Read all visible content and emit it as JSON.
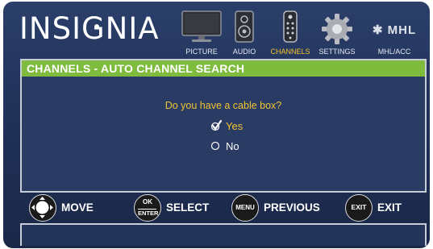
{
  "brand": {
    "name_a": "INSI",
    "name_b": "G",
    "name_c": "NIA"
  },
  "nav": {
    "tabs": [
      {
        "key": "picture",
        "label": "PICTURE",
        "active": false
      },
      {
        "key": "audio",
        "label": "AUDIO",
        "active": false
      },
      {
        "key": "channels",
        "label": "CHANNELS",
        "active": true
      },
      {
        "key": "settings",
        "label": "SETTINGS",
        "active": false
      },
      {
        "key": "mhl",
        "label": "MHL/ACC",
        "logo": "MHL",
        "active": false
      }
    ]
  },
  "panel": {
    "title": "CHANNELS - AUTO CHANNEL SEARCH",
    "question": "Do you have a cable box?",
    "options": [
      {
        "label": "Yes",
        "selected": true
      },
      {
        "label": "No",
        "selected": false
      }
    ]
  },
  "controls": [
    {
      "button_text": "",
      "label": "MOVE",
      "icon": "directional-pad-icon"
    },
    {
      "button_text_top": "OK",
      "button_text_bottom": "ENTER",
      "label": "SELECT",
      "icon": "ok-enter-button"
    },
    {
      "button_text": "MENU",
      "label": "PREVIOUS",
      "icon": "menu-button"
    },
    {
      "button_text": "EXIT",
      "label": "EXIT",
      "icon": "exit-button"
    }
  ],
  "colors": {
    "background": "#1f2f55",
    "header_green": "#7fbb3d",
    "highlight_yellow": "#f1c431",
    "text_white": "#ffffff"
  }
}
